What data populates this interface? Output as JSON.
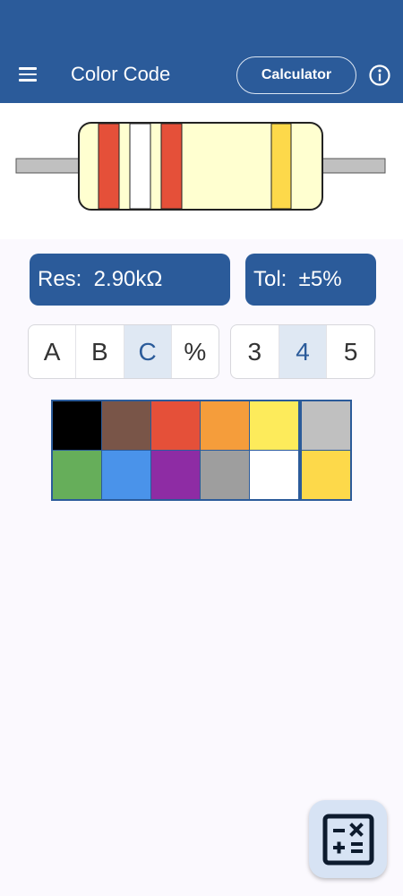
{
  "app_bar": {
    "title": "Color Code",
    "calculator_label": "Calculator",
    "menu_icon": "menu-icon",
    "info_icon": "info-icon",
    "color": "#2b5b9a"
  },
  "resistor": {
    "body_color": "#ffffd0",
    "lead_color": "#c0c0c0",
    "bands": [
      {
        "name": "red",
        "color": "#e55039"
      },
      {
        "name": "white",
        "color": "#ffffff"
      },
      {
        "name": "red",
        "color": "#e55039"
      },
      {
        "name": "gold",
        "color": "#fdd94a"
      }
    ]
  },
  "readouts": {
    "resistance": "Res:  2.90kΩ",
    "tolerance": "Tol:  ±5%"
  },
  "band_selector": {
    "options": [
      "A",
      "B",
      "C",
      "%"
    ],
    "selected": "C"
  },
  "band_count": {
    "options": [
      "3",
      "4",
      "5"
    ],
    "selected": "4"
  },
  "palette": {
    "colors": [
      {
        "name": "black",
        "hex": "#000000"
      },
      {
        "name": "brown",
        "hex": "#795548"
      },
      {
        "name": "red",
        "hex": "#e55039"
      },
      {
        "name": "orange",
        "hex": "#f59d3b"
      },
      {
        "name": "yellow",
        "hex": "#fdeb5b"
      },
      {
        "name": "silver",
        "hex": "#c0c0c0"
      },
      {
        "name": "green",
        "hex": "#66ae5a"
      },
      {
        "name": "blue",
        "hex": "#4a93ea"
      },
      {
        "name": "violet",
        "hex": "#8e2ca4"
      },
      {
        "name": "gray",
        "hex": "#9e9e9e"
      },
      {
        "name": "white",
        "hex": "#ffffff"
      },
      {
        "name": "gold",
        "hex": "#fdd94a"
      }
    ]
  },
  "fab": {
    "icon": "calculator-icon",
    "color": "#d7e3f4"
  }
}
